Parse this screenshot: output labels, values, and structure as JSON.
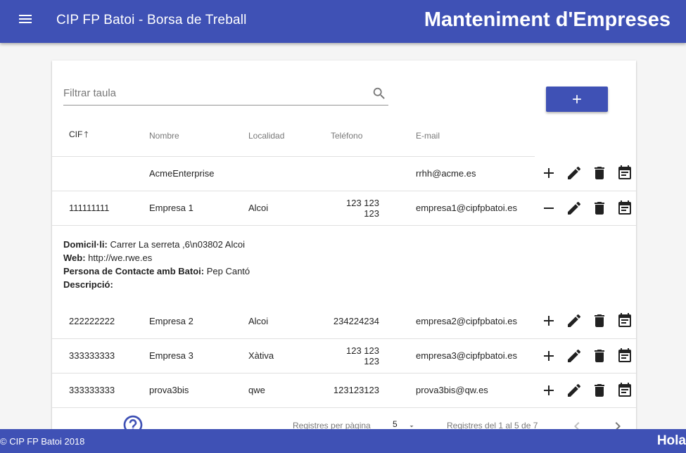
{
  "header": {
    "title": "CIP FP Batoi - Borsa de Treball",
    "page_heading": "Manteniment d'Empreses",
    "menu_icon": "menu-icon"
  },
  "filter": {
    "placeholder": "Filtrar taula",
    "value": ""
  },
  "table": {
    "headers": {
      "cif": "CIF",
      "nombre": "Nombre",
      "localidad": "Localidad",
      "telefono": "Teléfono",
      "email": "E-mail"
    },
    "rows": [
      {
        "cif": "",
        "nombre": "AcmeEnterprise",
        "localidad": "",
        "telefono": "",
        "email": "rrhh@acme.es"
      },
      {
        "cif": "111111111",
        "nombre": "Empresa 1",
        "localidad": "Alcoi",
        "telefono": "123 123 123",
        "email": "empresa1@cipfpbatoi.es"
      },
      {
        "cif": "222222222",
        "nombre": "Empresa 2",
        "localidad": "Alcoi",
        "telefono": "234224234",
        "email": "empresa2@cipfpbatoi.es"
      },
      {
        "cif": "333333333",
        "nombre": "Empresa 3",
        "localidad": "Xàtiva",
        "telefono": "123 123 123",
        "email": "empresa3@cipfpbatoi.es"
      },
      {
        "cif": "333333333",
        "nombre": "prova3bis",
        "localidad": "qwe",
        "telefono": "123123123",
        "email": "prova3bis@qw.es"
      }
    ],
    "expanded": {
      "domicili_label": "Domicil·li:",
      "domicili_value": " Carrer La serreta ,6\\n03802 Alcoi",
      "web_label": "Web:",
      "web_value": " http://we.rwe.es",
      "persona_label": "Persona de Contacte amb Batoi:",
      "persona_value": " Pep Cantó",
      "descripcio_label": "Descripció:",
      "descripcio_value": ""
    }
  },
  "pagination": {
    "rows_per_page_label": "Registres per pàgina",
    "rows_per_page": "5",
    "range": "Registres del 1 al 5 de 7"
  },
  "footer": {
    "copyright": "© CIP FP Batoi 2018",
    "greeting": "Hola"
  },
  "colors": {
    "primary": "#3f51b5"
  }
}
